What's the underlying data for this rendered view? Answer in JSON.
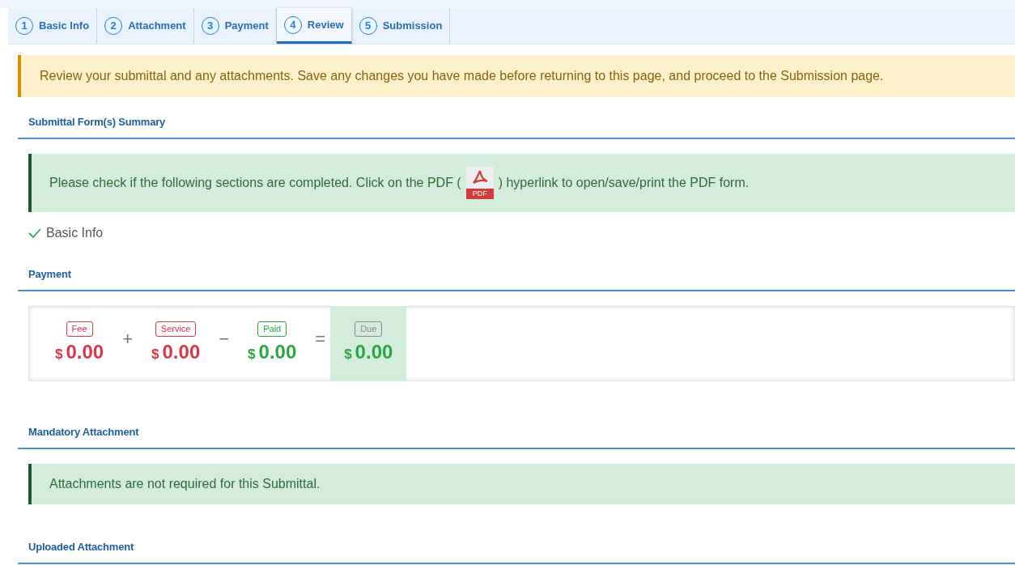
{
  "tabs": [
    {
      "number": "1",
      "label": "Basic Info",
      "selected": false
    },
    {
      "number": "2",
      "label": "Attachment",
      "selected": false
    },
    {
      "number": "3",
      "label": "Payment",
      "selected": false
    },
    {
      "number": "4",
      "label": "Review",
      "selected": true
    },
    {
      "number": "5",
      "label": "Submission",
      "selected": false
    }
  ],
  "warning": "Review your submittal and any attachments. Save any changes you have made before returning to this page, and proceed to the Submission page.",
  "summary": {
    "heading": "Submittal Form(s) Summary",
    "note_before": "Please check if the following sections are completed. Click on the PDF (",
    "pdf_label": "PDF",
    "note_after": ") hyperlink to open/save/print the PDF form.",
    "sections": [
      {
        "label": "Basic Info",
        "checked": true
      }
    ]
  },
  "payment": {
    "heading": "Payment",
    "items": [
      {
        "kind": "charge",
        "badge": "Fee",
        "currency": "$",
        "amount": "0.00",
        "operator": "+"
      },
      {
        "kind": "charge",
        "badge": "Service",
        "currency": "$",
        "amount": "0.00",
        "operator": "−"
      },
      {
        "kind": "credit",
        "badge": "Paid",
        "currency": "$",
        "amount": "0.00",
        "operator": "="
      },
      {
        "kind": "total",
        "badge": "Due",
        "currency": "$",
        "amount": "0.00"
      }
    ]
  },
  "mandatory": {
    "heading": "Mandatory Attachment",
    "note": "Attachments are not required for this Submittal."
  },
  "uploaded": {
    "heading": "Uploaded Attachment"
  }
}
